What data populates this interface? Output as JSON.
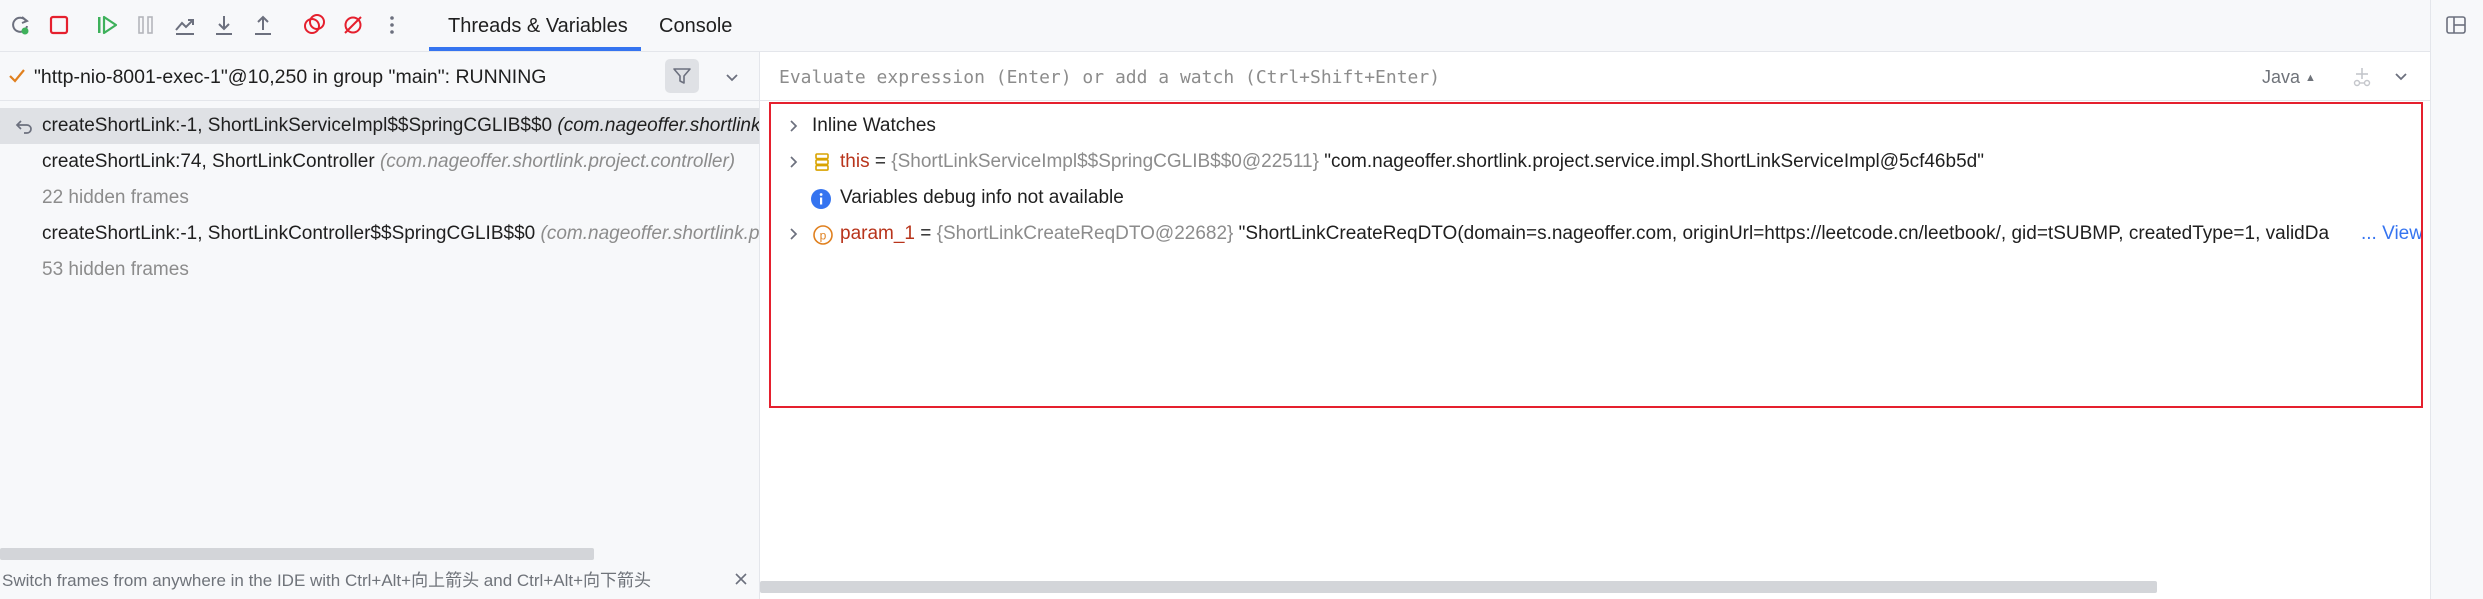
{
  "toolbar": {
    "icons": [
      "rerun-icon",
      "stop-icon",
      "resume-icon",
      "pause-icon",
      "step-over-icon",
      "step-into-icon",
      "step-out-icon",
      "view-breakpoints-icon",
      "mute-breakpoints-icon",
      "more-icon"
    ],
    "tabs": [
      {
        "label": "Threads & Variables",
        "active": true
      },
      {
        "label": "Console",
        "active": false
      }
    ],
    "layout_icon": "layout-icon"
  },
  "thread": {
    "status_icon": "check-icon",
    "label": "\"http-nio-8001-exec-1\"@10,250 in group \"main\": RUNNING"
  },
  "frames": [
    {
      "name": "createShortLink:-1, ShortLinkServiceImpl$$SpringCGLIB$$0 ",
      "package": "(com.nageoffer.shortlink.project.service.impl)",
      "selected": true,
      "hidden": false
    },
    {
      "name": "createShortLink:74, ShortLinkController ",
      "package": "(com.nageoffer.shortlink.project.controller)",
      "selected": false,
      "hidden": false
    },
    {
      "name": "22 hidden frames",
      "package": "",
      "selected": false,
      "hidden": true
    },
    {
      "name": "createShortLink:-1, ShortLinkController$$SpringCGLIB$$0 ",
      "package": "(com.nageoffer.shortlink.project.controller)",
      "selected": false,
      "hidden": false
    },
    {
      "name": "53 hidden frames",
      "package": "",
      "selected": false,
      "hidden": true
    }
  ],
  "hint": {
    "text": "Switch frames from anywhere in the IDE with Ctrl+Alt+向上箭头 and Ctrl+Alt+向下箭头"
  },
  "evaluate": {
    "placeholder": "Evaluate expression (Enter) or add a watch (Ctrl+Shift+Enter)",
    "language": "Java"
  },
  "variables": {
    "inline_watches": "Inline Watches",
    "this": {
      "name": "this",
      "eq": " = ",
      "type": "{ShortLinkServiceImpl$$SpringCGLIB$$0@22511}",
      "value": " \"com.nageoffer.shortlink.project.service.impl.ShortLinkServiceImpl@5cf46b5d\""
    },
    "info": "Variables debug info not available",
    "param": {
      "name": "param_1",
      "eq": " = ",
      "type": "{ShortLinkCreateReqDTO@22682}",
      "value": " \"ShortLinkCreateReqDTO(domain=s.nageoffer.com, originUrl=https://leetcode.cn/leetbook/, gid=tSUBMP, createdType=1, validDa",
      "view_link": "... View"
    }
  },
  "colors": {
    "accent": "#3574f0",
    "highlight_box": "#e5202e",
    "variable_name": "#b8341b",
    "muted": "#8c8c8c",
    "stop": "#e5202e",
    "run": "#3eb15b"
  }
}
